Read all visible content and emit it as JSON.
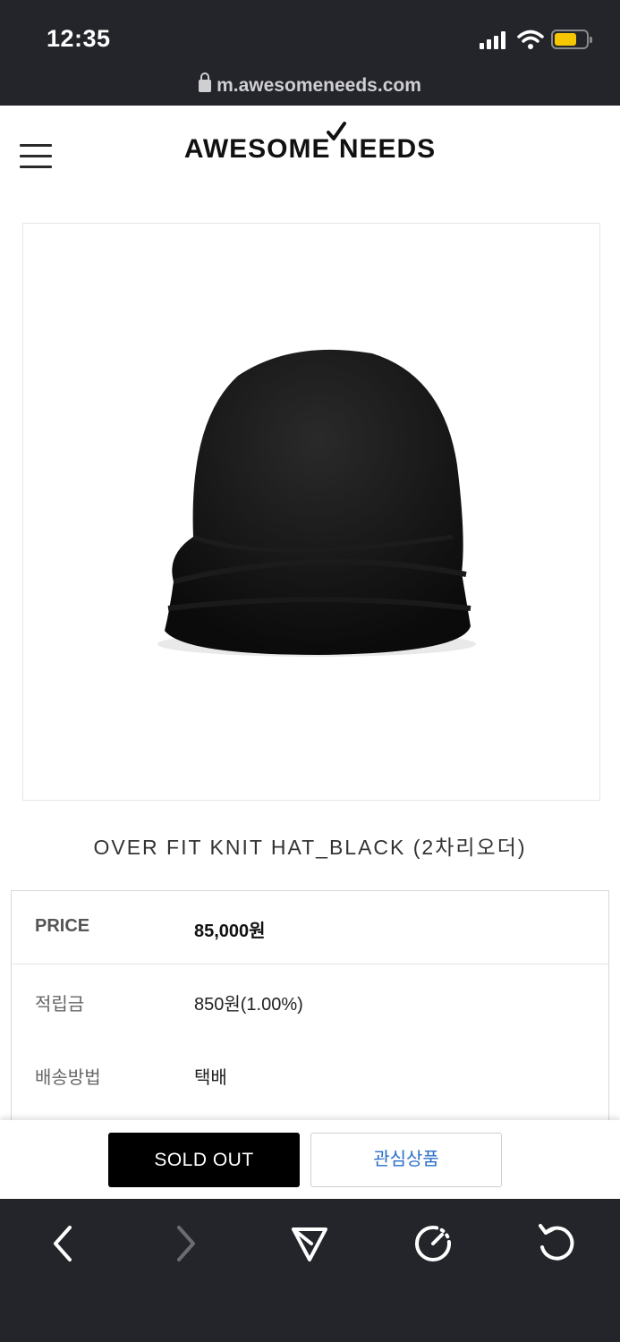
{
  "status_bar": {
    "time": "12:35"
  },
  "browser": {
    "url": "m.awesomeneeds.com"
  },
  "site": {
    "logo_text": "AWESOME NEEDS"
  },
  "product": {
    "name": "OVER FIT KNIT HAT_BLACK (2차리오더)",
    "image_icon": "black-knit-hat-image"
  },
  "info": {
    "price_label": "PRICE",
    "price_value": "85,000원",
    "points_label": "적립금",
    "points_value": "850원(1.00%)",
    "shipping_label": "배송방법",
    "shipping_value": "택배"
  },
  "actions": {
    "soldout_label": "SOLD OUT",
    "wishlist_label": "관심상품"
  },
  "toolbar": {
    "icons": [
      "back-icon",
      "forward-icon",
      "share-icon",
      "speed-icon",
      "reload-icon"
    ]
  },
  "colors": {
    "status_bg": "#24252a",
    "battery": "#f6c600",
    "wishlist_text": "#2a6fc9",
    "soldout_bg": "#000000"
  }
}
